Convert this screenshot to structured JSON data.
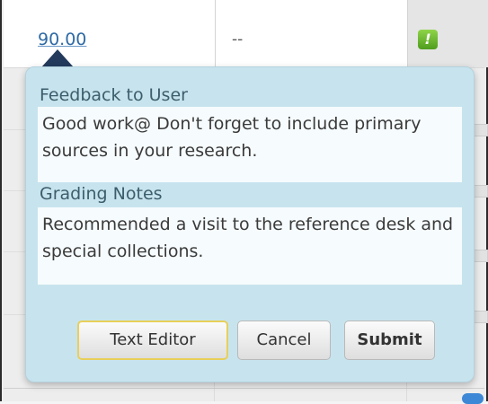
{
  "grade_row": {
    "grade_value": "90.00",
    "status_value": "--",
    "flag_icon": "exclamation-icon",
    "flag_glyph": "!"
  },
  "popup": {
    "feedback_label": "Feedback to User",
    "feedback_text": "Good work@ Don't forget to include primary sources in your research.",
    "notes_label": "Grading Notes",
    "notes_text": "Recommended a visit to the reference desk and special collections."
  },
  "buttons": {
    "text_editor": "Text Editor",
    "cancel": "Cancel",
    "submit": "Submit"
  },
  "colors": {
    "popup_background": "#c7e4ee",
    "grade_link": "#2f6aa5",
    "flag_green": "#5aa826"
  }
}
